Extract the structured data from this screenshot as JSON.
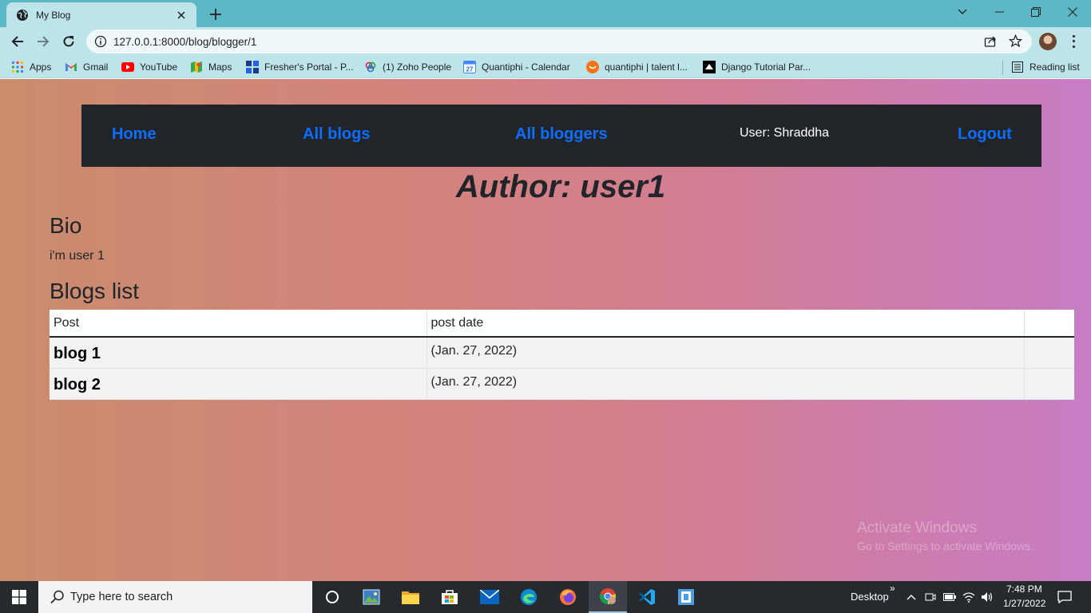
{
  "browser": {
    "tab_title": "My Blog",
    "url": "127.0.0.1:8000/blog/blogger/1",
    "bookmarks": [
      {
        "label": "Apps",
        "icon": "apps-grid-icon"
      },
      {
        "label": "Gmail",
        "icon": "gmail-icon"
      },
      {
        "label": "YouTube",
        "icon": "youtube-icon"
      },
      {
        "label": "Maps",
        "icon": "maps-icon"
      },
      {
        "label": "Fresher's Portal - P...",
        "icon": "portal-icon"
      },
      {
        "label": "(1) Zoho People",
        "icon": "zoho-icon"
      },
      {
        "label": "Quantiphi - Calendar",
        "icon": "calendar-icon"
      },
      {
        "label": "quantiphi | talent l...",
        "icon": "talent-icon"
      },
      {
        "label": "Django Tutorial Par...",
        "icon": "mdn-icon"
      }
    ],
    "reading_list": "Reading list"
  },
  "nav": {
    "home": "Home",
    "all_blogs": "All blogs",
    "all_bloggers": "All bloggers",
    "user": "User: Shraddha",
    "logout": "Logout"
  },
  "main": {
    "author_heading": "Author: user1",
    "bio_heading": "Bio",
    "bio_text": "i'm user 1",
    "blogs_heading": "Blogs list",
    "table": {
      "headers": [
        "Post",
        "post date",
        ""
      ],
      "rows": [
        {
          "post": "blog 1",
          "date": "(Jan. 27, 2022)"
        },
        {
          "post": "blog 2",
          "date": "(Jan. 27, 2022)"
        }
      ]
    }
  },
  "watermark": {
    "line1": "Activate Windows",
    "line2": "Go to Settings to activate Windows."
  },
  "taskbar": {
    "search_placeholder": "Type here to search",
    "desktop_label": "Desktop",
    "time": "7:48 PM",
    "date": "1/27/2022"
  },
  "colors": {
    "navbar_bg": "#212529",
    "link": "#0d6efd",
    "gradient_start": "#c98c6c",
    "gradient_end": "#c77cc5",
    "chrome_tabbar": "#5cb8c4",
    "chrome_toolbar": "#bde4e9"
  }
}
